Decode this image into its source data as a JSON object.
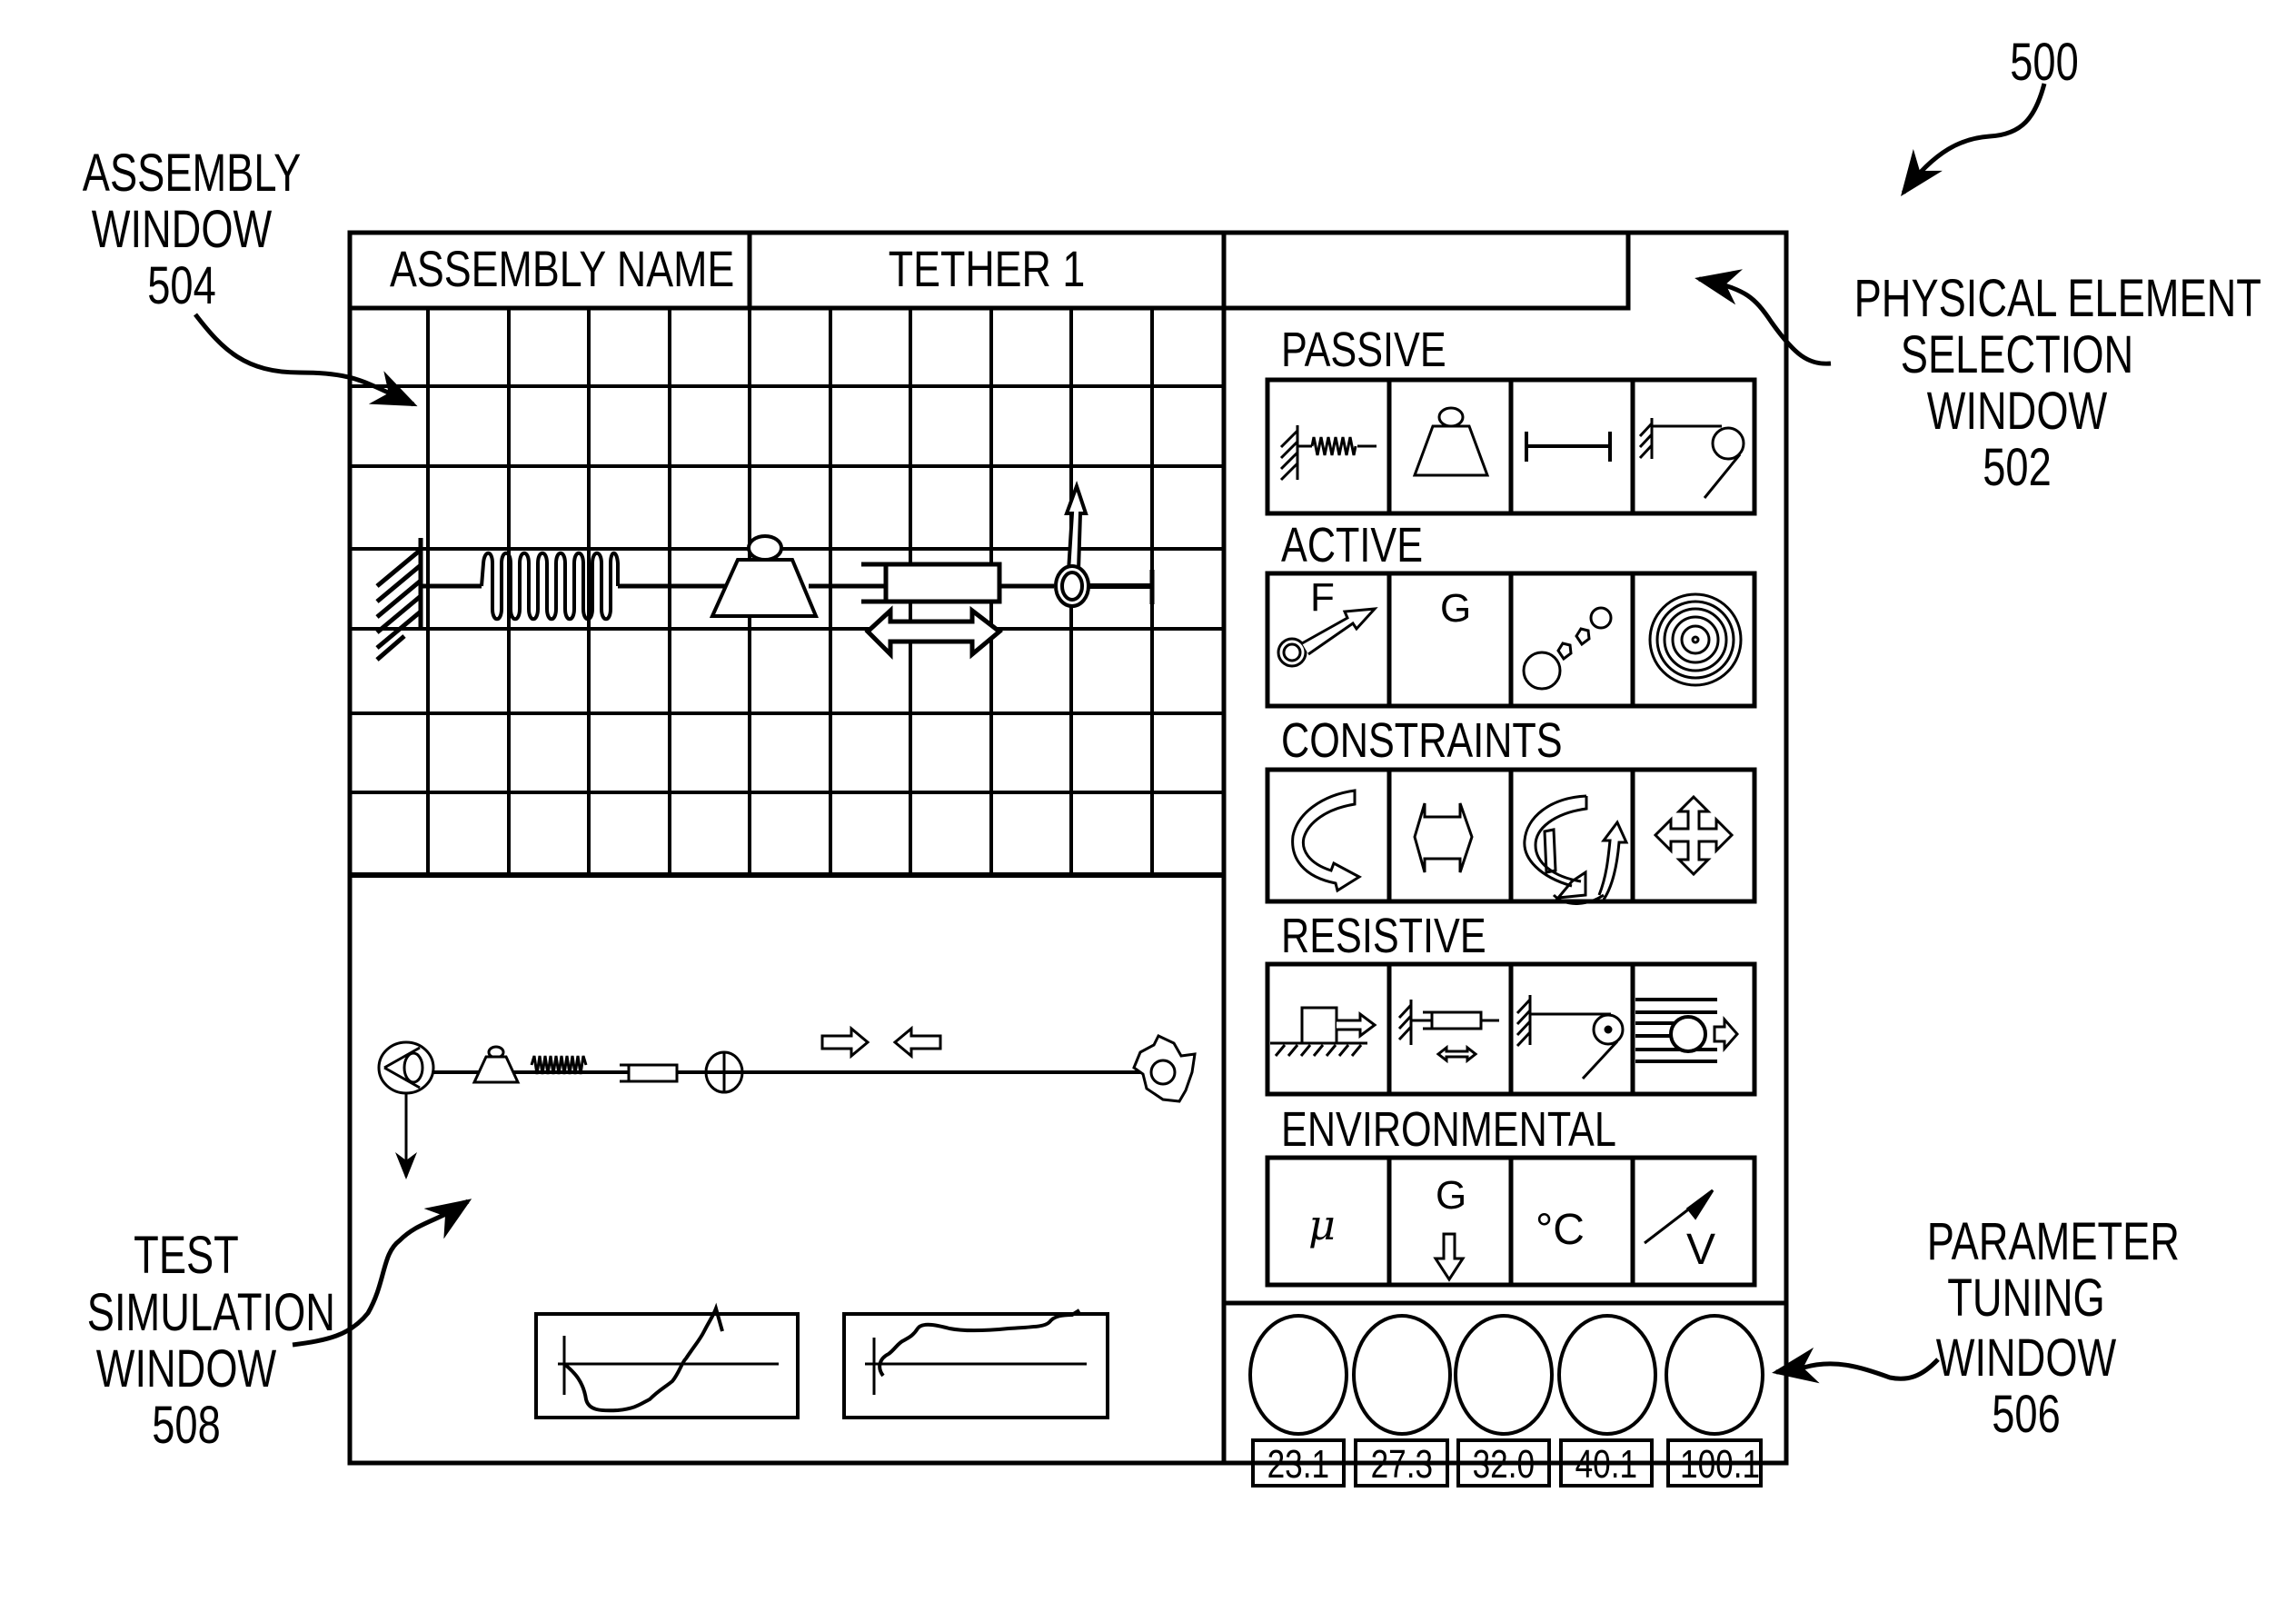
{
  "figure": {
    "reference_number": "500",
    "callouts": {
      "assembly_window": [
        "ASSEMBLY",
        "WINDOW",
        "504"
      ],
      "physical_element_selection_window": [
        "PHYSICAL  ELEMENT",
        "SELECTION",
        "WINDOW",
        "502"
      ],
      "parameter_tuning_window": [
        "PARAMETER",
        "TUNING",
        "WINDOW",
        "506"
      ],
      "test_simulation_window": [
        "TEST",
        "SIMULATION",
        "WINDOW",
        "508"
      ]
    }
  },
  "header": {
    "name_label": "ASSEMBLY  NAME",
    "name_value": "TETHER  1",
    "extra_field": ""
  },
  "assembly_window": {
    "elements": [
      "fixed-wall",
      "spring",
      "mass",
      "damper-actuator",
      "force-lever",
      "end-stop"
    ]
  },
  "element_selection": {
    "categories": [
      {
        "label": "PASSIVE",
        "icons": [
          "spring-icon",
          "mass-icon",
          "rigid-link-icon",
          "pulley-cable-icon"
        ]
      },
      {
        "label": "ACTIVE",
        "icons": [
          "force-icon",
          "gravity-icon",
          "particles-icon",
          "vibration-icon"
        ],
        "glyphs": {
          "force": "F",
          "gravity": "G"
        }
      },
      {
        "label": "CONSTRAINTS",
        "icons": [
          "rotation-constraint-icon",
          "linear-constraint-icon",
          "multi-axis-rotation-icon",
          "planar-translation-icon"
        ]
      },
      {
        "label": "RESISTIVE",
        "icons": [
          "sliding-friction-icon",
          "damper-icon",
          "cable-friction-icon",
          "fluid-drag-icon"
        ]
      },
      {
        "label": "ENVIRONMENTAL",
        "icons": [
          "friction-coefficient-icon",
          "gravity-direction-icon",
          "temperature-icon",
          "velocity-icon"
        ],
        "glyphs": {
          "mu": "μ",
          "gravity": "G",
          "temperature": "°C",
          "velocity": "V"
        }
      }
    ]
  },
  "parameter_tuning": {
    "knobs": [
      {
        "value": "23.1"
      },
      {
        "value": "27.3"
      },
      {
        "value": "32.0"
      },
      {
        "value": "40.1"
      },
      {
        "value": "100.1"
      }
    ]
  },
  "test_simulation": {
    "chain": [
      "sensor-eye",
      "mass",
      "spring",
      "damper",
      "cross-joint",
      "gear-anchor"
    ],
    "plots": [
      {
        "name": "response-plot-1",
        "trend": "dips below axis then rises sharply"
      },
      {
        "name": "response-plot-2",
        "trend": "rises quickly then plateaus above axis"
      }
    ]
  }
}
